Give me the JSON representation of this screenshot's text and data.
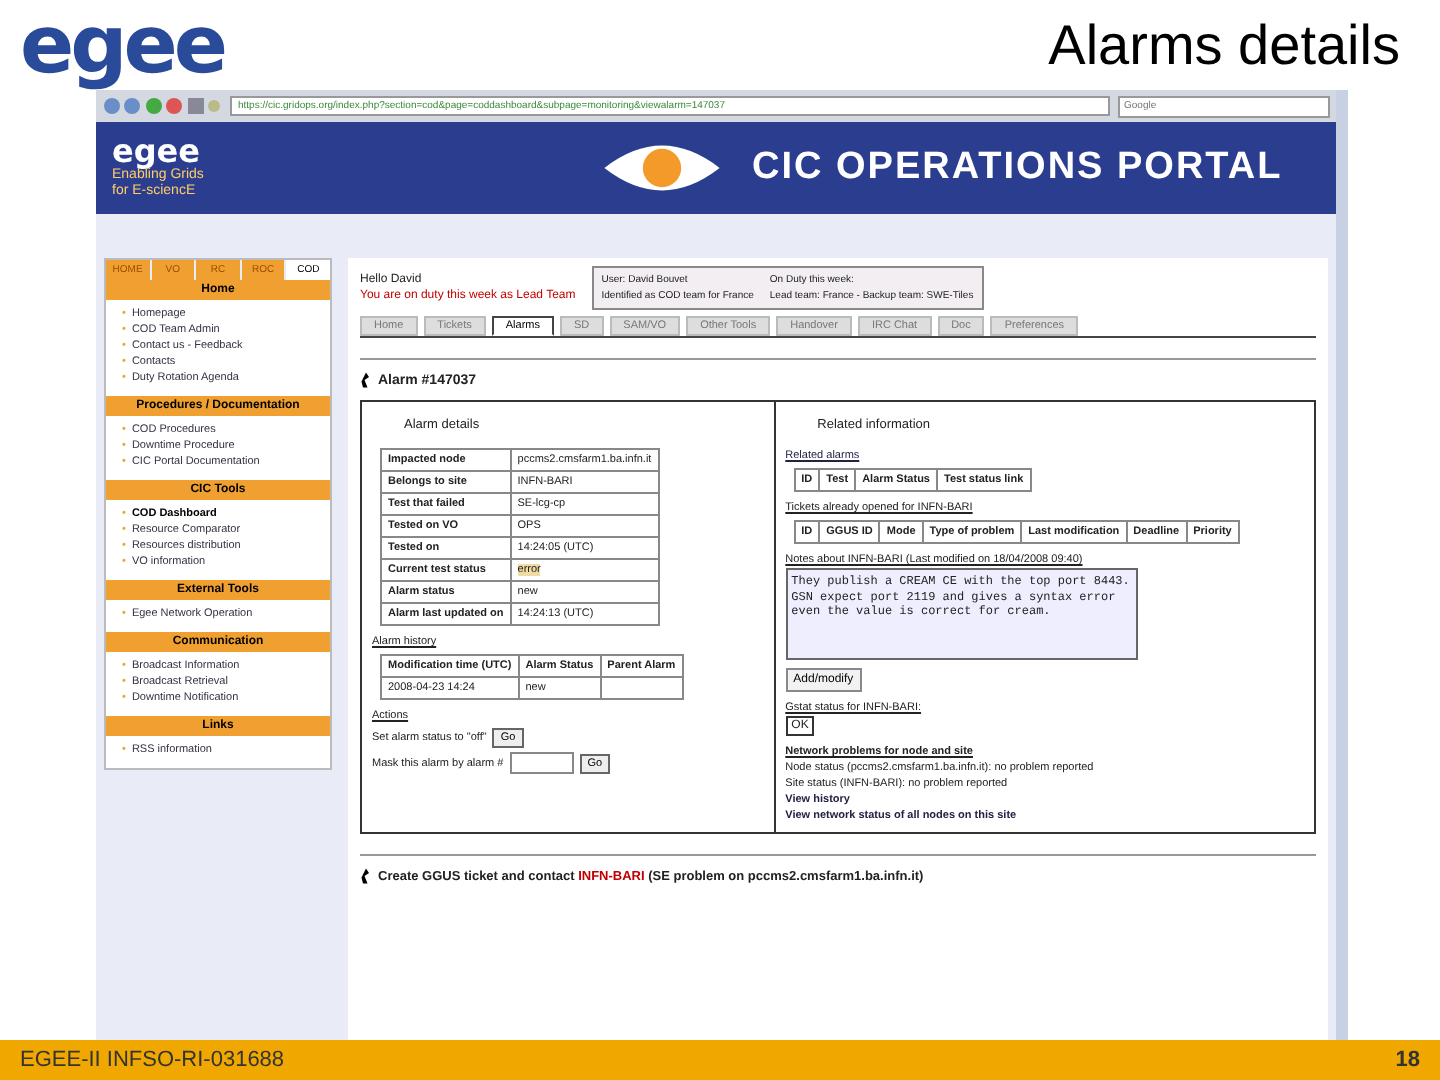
{
  "slide": {
    "logo": "egee",
    "title": "Alarms details",
    "footer": "EGEE-II INFSO-RI-031688",
    "page": "18"
  },
  "browser": {
    "url": "https://cic.gridops.org/index.php?section=cod&page=coddashboard&subpage=monitoring&viewalarm=147037",
    "search_placeholder": "Google"
  },
  "banner": {
    "logo": "egee",
    "tagline_1": "Enabling Grids",
    "tagline_2": "for E-sciencE",
    "title": "CIC OPERATIONS PORTAL"
  },
  "sidebar": {
    "bullet": "•",
    "tabs": [
      {
        "label": "HOME",
        "selected": false
      },
      {
        "label": "VO",
        "selected": false
      },
      {
        "label": "RC",
        "selected": false
      },
      {
        "label": "ROC",
        "selected": false
      },
      {
        "label": "COD",
        "selected": true
      }
    ],
    "sections": [
      {
        "title": "Home",
        "items": [
          {
            "label": "Homepage",
            "selected": false
          },
          {
            "label": "COD Team Admin",
            "selected": false
          },
          {
            "label": "Contact us - Feedback",
            "selected": false
          },
          {
            "label": "Contacts",
            "selected": false
          },
          {
            "label": "Duty Rotation Agenda",
            "selected": false
          }
        ]
      },
      {
        "title": "Procedures / Documentation",
        "items": [
          {
            "label": "COD Procedures",
            "selected": false
          },
          {
            "label": "Downtime Procedure",
            "selected": false
          },
          {
            "label": "CIC Portal Documentation",
            "selected": false
          }
        ]
      },
      {
        "title": "CIC Tools",
        "items": [
          {
            "label": "COD Dashboard",
            "selected": true
          },
          {
            "label": "Resource Comparator",
            "selected": false
          },
          {
            "label": "Resources distribution",
            "selected": false
          },
          {
            "label": "VO information",
            "selected": false
          }
        ]
      },
      {
        "title": "External Tools",
        "items": [
          {
            "label": "Egee Network Operation",
            "selected": false
          }
        ]
      },
      {
        "title": "Communication",
        "items": [
          {
            "label": "Broadcast Information",
            "selected": false
          },
          {
            "label": "Broadcast Retrieval",
            "selected": false
          },
          {
            "label": "Downtime Notification",
            "selected": false
          }
        ]
      },
      {
        "title": "Links",
        "items": [
          {
            "label": "RSS information",
            "selected": false
          }
        ]
      }
    ]
  },
  "user": {
    "greeting": "Hello David",
    "duty": "You are on duty this week as Lead Team",
    "user_line": "User: David Bouvet",
    "identified": "Identified as COD team for France",
    "on_duty": "On Duty this week:",
    "lead": "Lead team: France - Backup team: SWE-Tiles"
  },
  "tabs": [
    {
      "label": "Home",
      "selected": false
    },
    {
      "label": "Tickets",
      "selected": false
    },
    {
      "label": "Alarms",
      "selected": true
    },
    {
      "label": "SD",
      "selected": false
    },
    {
      "label": "SAM/VO",
      "selected": false
    },
    {
      "label": "Other Tools",
      "selected": false
    },
    {
      "label": "Handover",
      "selected": false
    },
    {
      "label": "IRC Chat",
      "selected": false
    },
    {
      "label": "Doc",
      "selected": false
    },
    {
      "label": "Preferences",
      "selected": false
    }
  ],
  "alarm": {
    "title": "Alarm #147037",
    "details_title": "Alarm details",
    "details": [
      {
        "label": "Impacted node",
        "value": "pccms2.cmsfarm1.ba.infn.it",
        "highlight": false
      },
      {
        "label": "Belongs to site",
        "value": "INFN-BARI",
        "highlight": false
      },
      {
        "label": "Test that failed",
        "value": "SE-lcg-cp",
        "highlight": false
      },
      {
        "label": "Tested on VO",
        "value": "OPS",
        "highlight": false
      },
      {
        "label": "Tested on",
        "value": "14:24:05 (UTC)",
        "highlight": false
      },
      {
        "label": "Current test status",
        "value": "error",
        "highlight": true
      },
      {
        "label": "Alarm status",
        "value": "new",
        "highlight": false
      },
      {
        "label": "Alarm last updated on",
        "value": "14:24:13 (UTC)",
        "highlight": false
      }
    ],
    "history_title": "Alarm history",
    "history_columns": [
      "Modification time (UTC)",
      "Alarm Status",
      "Parent Alarm"
    ],
    "history_rows": [
      [
        "2008-04-23 14:24",
        "new",
        ""
      ]
    ],
    "actions_title": "Actions",
    "action_1": "Set alarm status to \"off\"",
    "action_2": "Mask this alarm by alarm #",
    "go": "Go",
    "go_2": "Go"
  },
  "related": {
    "title": "Related information",
    "alarms_link": "Related alarms",
    "alarms_columns": [
      "ID",
      "Test",
      "Alarm Status",
      "Test status link"
    ],
    "tickets_title": "Tickets already opened for INFN-BARI",
    "tickets_columns": [
      "ID",
      "GGUS ID",
      "Mode",
      "Type of problem",
      "Last modification",
      "Deadline",
      "Priority"
    ],
    "notes_title": "Notes about INFN-BARI (Last modified on 18/04/2008 09:40)",
    "notes": "They publish a CREAM CE with the top port 8443. GSN expect port 2119 and gives a syntax error even the value is correct for cream.",
    "add_button": "Add/modify",
    "gstat_title": "Gstat status for INFN-BARI:",
    "gstat_value": "OK",
    "network_title": "Network problems for node and site",
    "node_status": "Node status (pccms2.cmsfarm1.ba.infn.it): no problem reported",
    "site_status": "Site status (INFN-BARI): no problem reported",
    "history_link": "View history",
    "network_link": "View network status of all nodes on this site"
  },
  "ggus": {
    "prefix": "Create GGUS ticket and contact",
    "site": "INFN-BARI",
    "suffix": "(SE problem on pccms2.cmsfarm1.ba.infn.it)"
  }
}
